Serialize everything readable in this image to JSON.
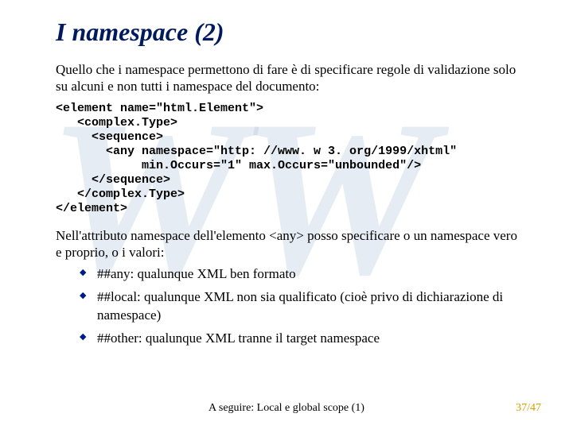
{
  "title": "I namespace (2)",
  "intro": "Quello che i namespace permettono di fare è di specificare regole di validazione solo su alcuni e non tutti i namespace del documento:",
  "code": "<element name=\"html.Element\">\n   <complex.Type>\n     <sequence>\n       <any namespace=\"http: //www. w 3. org/1999/xhtml\"\n            min.Occurs=\"1\" max.Occurs=\"unbounded\"/>\n     </sequence>\n   </complex.Type>\n</element>",
  "para2": "Nell'attributo namespace dell'elemento <any> posso specificare o un namespace vero e proprio, o i valori:",
  "bullets": {
    "b1": "##any: qualunque XML ben formato",
    "b2": "##local: qualunque XML non sia qualificato (cioè privo di dichiarazione di namespace)",
    "b3": "##other: qualunque XML tranne il target namespace"
  },
  "footer_center": "A seguire: Local e global scope (1)",
  "footer_right": "37/47",
  "watermark": "WW"
}
